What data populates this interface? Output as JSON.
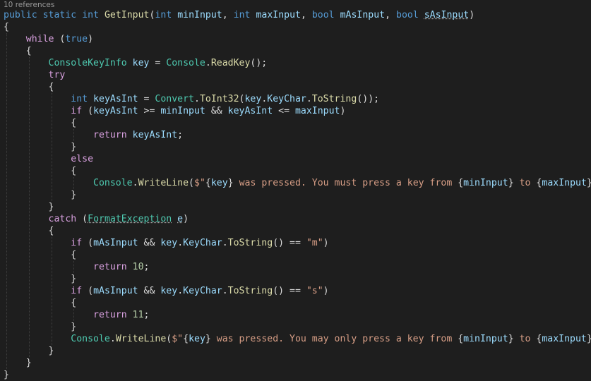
{
  "codelens": {
    "text": "10 references"
  },
  "colors": {
    "background": "#1e1e1e",
    "keyword": "#569cd6",
    "control_keyword": "#d8a0df",
    "type": "#4ec9b0",
    "method": "#dcdcaa",
    "identifier": "#9cdcfe",
    "string": "#d69d85",
    "number": "#b5cea8",
    "punctuation": "#dcdcdc"
  },
  "lines": [
    [
      [
        "kw",
        "public"
      ],
      [
        "p",
        " "
      ],
      [
        "kw",
        "static"
      ],
      [
        "p",
        " "
      ],
      [
        "kw",
        "int"
      ],
      [
        "p",
        " "
      ],
      [
        "meth",
        "GetInput"
      ],
      [
        "p",
        "("
      ],
      [
        "kw",
        "int"
      ],
      [
        "p",
        " "
      ],
      [
        "id",
        "minInput"
      ],
      [
        "p",
        ", "
      ],
      [
        "kw",
        "int"
      ],
      [
        "p",
        " "
      ],
      [
        "id",
        "maxInput"
      ],
      [
        "p",
        ", "
      ],
      [
        "kw",
        "bool"
      ],
      [
        "p",
        " "
      ],
      [
        "id",
        "mAsInput"
      ],
      [
        "p",
        ", "
      ],
      [
        "kw",
        "bool"
      ],
      [
        "p",
        " "
      ],
      [
        "id sq",
        "sAsInput"
      ],
      [
        "p",
        ")"
      ]
    ],
    [
      [
        "p",
        "{"
      ]
    ],
    [
      [
        "p",
        "    "
      ],
      [
        "kw2",
        "while"
      ],
      [
        "p",
        " ("
      ],
      [
        "kw",
        "true"
      ],
      [
        "p",
        ")"
      ]
    ],
    [
      [
        "p",
        "    {"
      ]
    ],
    [
      [
        "p",
        "        "
      ],
      [
        "type",
        "ConsoleKeyInfo"
      ],
      [
        "p",
        " "
      ],
      [
        "id",
        "key"
      ],
      [
        "p",
        " = "
      ],
      [
        "type",
        "Console"
      ],
      [
        "p",
        "."
      ],
      [
        "meth",
        "ReadKey"
      ],
      [
        "p",
        "();"
      ]
    ],
    [
      [
        "p",
        "        "
      ],
      [
        "kw2",
        "try"
      ]
    ],
    [
      [
        "p",
        "        {"
      ]
    ],
    [
      [
        "p",
        "            "
      ],
      [
        "kw",
        "int"
      ],
      [
        "p",
        " "
      ],
      [
        "id",
        "keyAsInt"
      ],
      [
        "p",
        " = "
      ],
      [
        "type",
        "Convert"
      ],
      [
        "p",
        "."
      ],
      [
        "meth",
        "ToInt32"
      ],
      [
        "p",
        "("
      ],
      [
        "id",
        "key"
      ],
      [
        "p",
        "."
      ],
      [
        "id",
        "KeyChar"
      ],
      [
        "p",
        "."
      ],
      [
        "meth",
        "ToString"
      ],
      [
        "p",
        "());"
      ]
    ],
    [
      [
        "p",
        "            "
      ],
      [
        "kw2",
        "if"
      ],
      [
        "p",
        " ("
      ],
      [
        "id",
        "keyAsInt"
      ],
      [
        "p",
        " >= "
      ],
      [
        "id",
        "minInput"
      ],
      [
        "p",
        " && "
      ],
      [
        "id",
        "keyAsInt"
      ],
      [
        "p",
        " <= "
      ],
      [
        "id",
        "maxInput"
      ],
      [
        "p",
        ")"
      ]
    ],
    [
      [
        "p",
        "            {"
      ]
    ],
    [
      [
        "p",
        "                "
      ],
      [
        "kw2",
        "return"
      ],
      [
        "p",
        " "
      ],
      [
        "id",
        "keyAsInt"
      ],
      [
        "p",
        ";"
      ]
    ],
    [
      [
        "p",
        "            }"
      ]
    ],
    [
      [
        "p",
        "            "
      ],
      [
        "kw2",
        "else"
      ]
    ],
    [
      [
        "p",
        "            {"
      ]
    ],
    [
      [
        "p",
        "                "
      ],
      [
        "type",
        "Console"
      ],
      [
        "p",
        "."
      ],
      [
        "meth",
        "WriteLine"
      ],
      [
        "p",
        "("
      ],
      [
        "str",
        "$\""
      ],
      [
        "p",
        "{"
      ],
      [
        "id",
        "key"
      ],
      [
        "p",
        "}"
      ],
      [
        "str",
        " was pressed. You must press a key from "
      ],
      [
        "p",
        "{"
      ],
      [
        "id",
        "minInput"
      ],
      [
        "p",
        "}"
      ],
      [
        "str",
        " to "
      ],
      [
        "p",
        "{"
      ],
      [
        "id",
        "maxInput"
      ],
      [
        "p",
        "}"
      ],
      [
        "str",
        "\""
      ],
      [
        "p",
        ");"
      ]
    ],
    [
      [
        "p",
        "            }"
      ]
    ],
    [
      [
        "p",
        "        }"
      ]
    ],
    [
      [
        "p",
        "        "
      ],
      [
        "kw2",
        "catch"
      ],
      [
        "p",
        " ("
      ],
      [
        "type sq",
        "FormatException"
      ],
      [
        "p",
        " "
      ],
      [
        "id sq",
        "e"
      ],
      [
        "p",
        ")"
      ]
    ],
    [
      [
        "p",
        "        {"
      ]
    ],
    [
      [
        "p",
        "            "
      ],
      [
        "kw2",
        "if"
      ],
      [
        "p",
        " ("
      ],
      [
        "id",
        "mAsInput"
      ],
      [
        "p",
        " && "
      ],
      [
        "id",
        "key"
      ],
      [
        "p",
        "."
      ],
      [
        "id",
        "KeyChar"
      ],
      [
        "p",
        "."
      ],
      [
        "meth",
        "ToString"
      ],
      [
        "p",
        "() == "
      ],
      [
        "str",
        "\"m\""
      ],
      [
        "p",
        ")"
      ]
    ],
    [
      [
        "p",
        "            {"
      ]
    ],
    [
      [
        "p",
        "                "
      ],
      [
        "kw2",
        "return"
      ],
      [
        "p",
        " "
      ],
      [
        "num",
        "10"
      ],
      [
        "p",
        ";"
      ]
    ],
    [
      [
        "p",
        "            }"
      ]
    ],
    [
      [
        "p",
        "            "
      ],
      [
        "kw2",
        "if"
      ],
      [
        "p",
        " ("
      ],
      [
        "id",
        "mAsInput"
      ],
      [
        "p",
        " && "
      ],
      [
        "id",
        "key"
      ],
      [
        "p",
        "."
      ],
      [
        "id",
        "KeyChar"
      ],
      [
        "p",
        "."
      ],
      [
        "meth",
        "ToString"
      ],
      [
        "p",
        "() == "
      ],
      [
        "str",
        "\"s\""
      ],
      [
        "p",
        ")"
      ]
    ],
    [
      [
        "p",
        "            {"
      ]
    ],
    [
      [
        "p",
        "                "
      ],
      [
        "kw2",
        "return"
      ],
      [
        "p",
        " "
      ],
      [
        "num",
        "11"
      ],
      [
        "p",
        ";"
      ]
    ],
    [
      [
        "p",
        "            }"
      ]
    ],
    [
      [
        "p",
        "            "
      ],
      [
        "type",
        "Console"
      ],
      [
        "p",
        "."
      ],
      [
        "meth",
        "WriteLine"
      ],
      [
        "p",
        "("
      ],
      [
        "str",
        "$\""
      ],
      [
        "p",
        "{"
      ],
      [
        "id",
        "key"
      ],
      [
        "p",
        "}"
      ],
      [
        "str",
        " was pressed. You may only press a key from "
      ],
      [
        "p",
        "{"
      ],
      [
        "id",
        "minInput"
      ],
      [
        "p",
        "}"
      ],
      [
        "str",
        " to "
      ],
      [
        "p",
        "{"
      ],
      [
        "id",
        "maxInput"
      ],
      [
        "p",
        "}"
      ],
      [
        "str",
        "\""
      ],
      [
        "p",
        ");"
      ]
    ],
    [
      [
        "p",
        "        }"
      ]
    ],
    [
      [
        "p",
        "    }"
      ]
    ],
    [
      [
        "p",
        "}"
      ]
    ]
  ]
}
